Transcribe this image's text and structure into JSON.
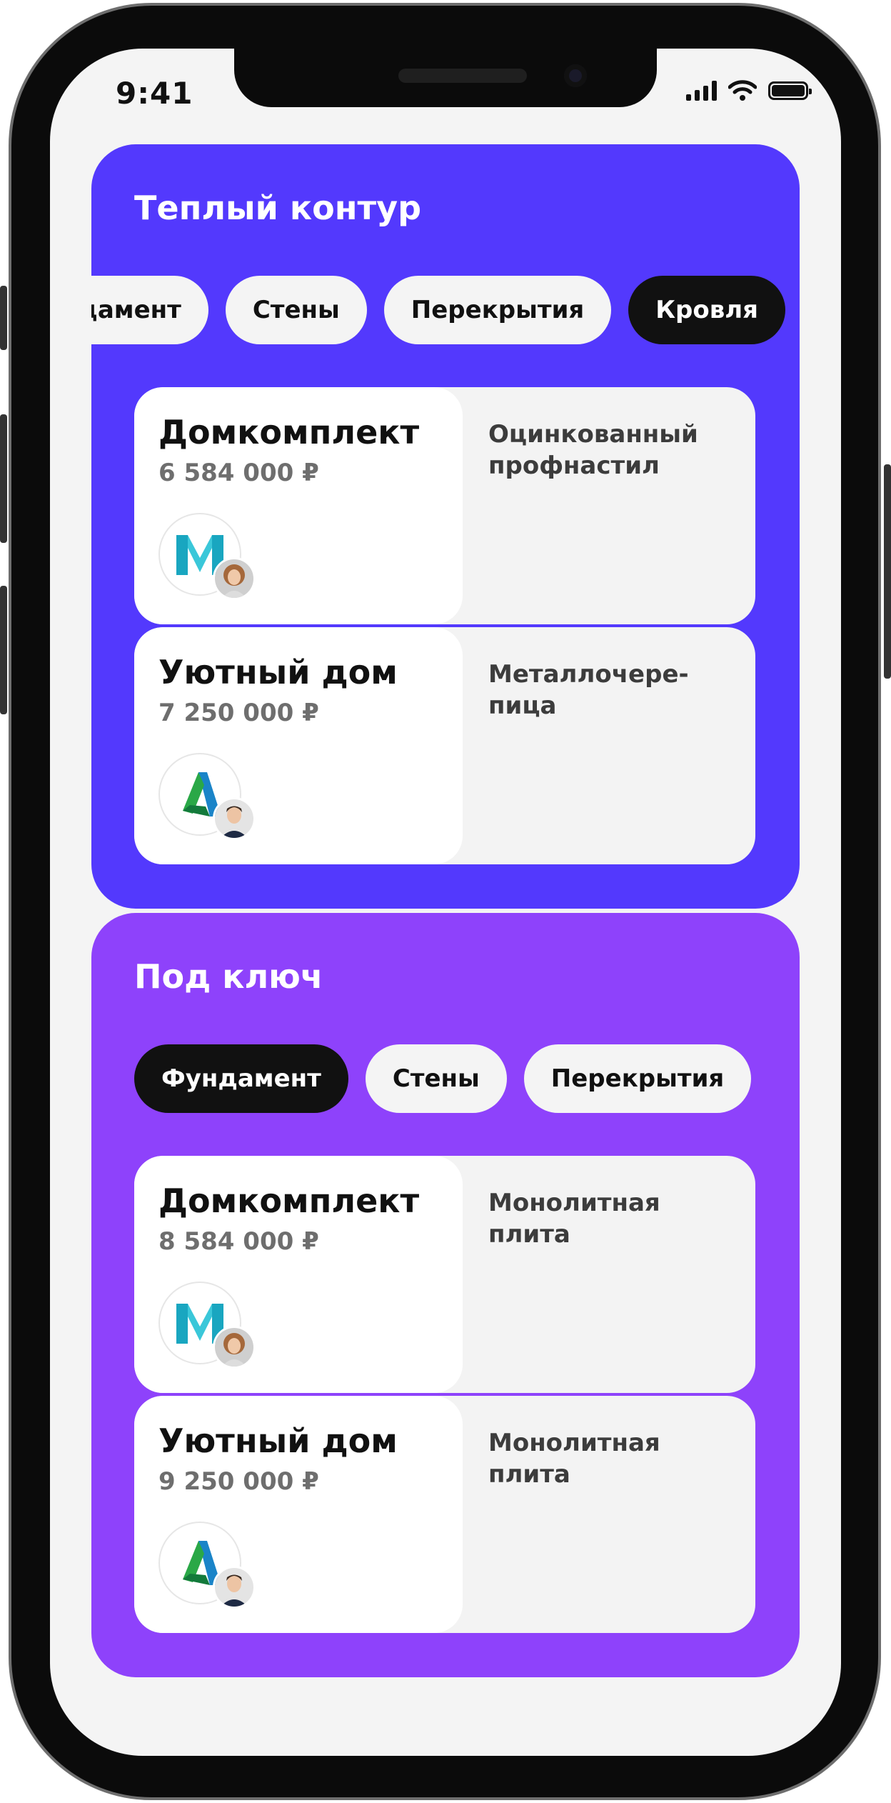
{
  "status_bar": {
    "time": "9:41"
  },
  "sections": [
    {
      "title": "Теплый контур",
      "chips": [
        "Фундамент",
        "Стены",
        "Перекрытия",
        "Кровля"
      ],
      "cards": [
        {
          "name": "Домкомплект",
          "price": "6 584 000 ₽",
          "description": "Оцинкованный профнастил",
          "logo_icon": "m-logo-icon",
          "avatar": "woman-avatar"
        },
        {
          "name": "Уютный дом",
          "price": "7 250 000 ₽",
          "description": "Металлочере-пица",
          "logo_icon": "a-logo-icon",
          "avatar": "man-avatar"
        }
      ]
    },
    {
      "title": "Под ключ",
      "chips": [
        "Фундамент",
        "Стены",
        "Перекрытия"
      ],
      "cards": [
        {
          "name": "Домкомплект",
          "price": "8 584 000 ₽",
          "description": "Монолитная плита",
          "logo_icon": "m-logo-icon",
          "avatar": "woman-avatar"
        },
        {
          "name": "Уютный дом",
          "price": "9 250 000 ₽",
          "description": "Монолитная плита",
          "logo_icon": "a-logo-icon",
          "avatar": "man-avatar"
        }
      ]
    }
  ],
  "colors": {
    "section_1_bg": "#5339fd",
    "section_2_bg": "#8e42fb",
    "chip_active": "#111111",
    "chip": "#f4f4f4"
  }
}
